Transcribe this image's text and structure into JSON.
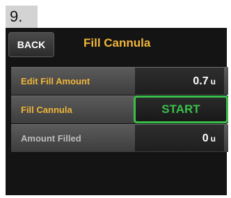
{
  "step": {
    "number": "9."
  },
  "header": {
    "back_label": "BACK",
    "title": "Fill Cannula"
  },
  "rows": [
    {
      "label": "Edit Fill Amount",
      "value": "0.7",
      "unit": "u"
    },
    {
      "label": "Fill Cannula",
      "button_label": "START"
    },
    {
      "label": "Amount Filled",
      "value": "0",
      "unit": "u"
    }
  ],
  "colors": {
    "title_accent": "#f0b53a",
    "start_green": "#3bbf4a",
    "screen_bg": "#141414"
  }
}
